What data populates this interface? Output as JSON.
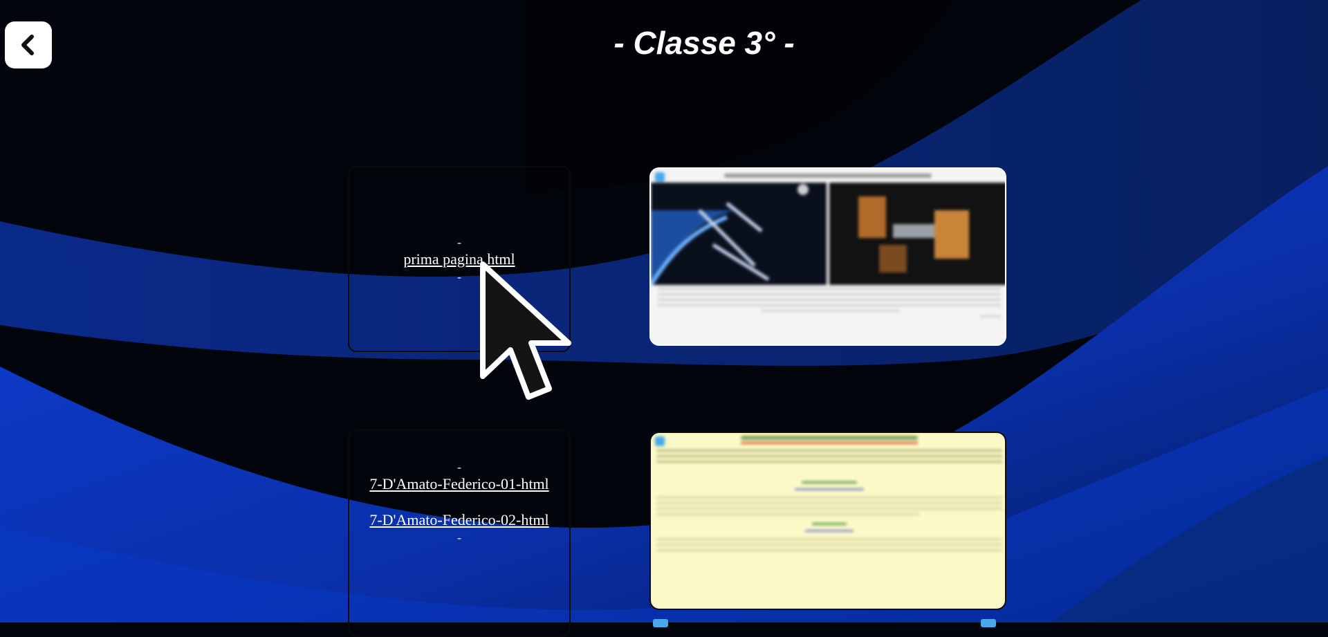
{
  "header": {
    "title": "- Classe 3° -",
    "back_icon": "chevron-left-icon"
  },
  "cards": [
    {
      "dash_top": "-",
      "links": [
        "prima pagina html"
      ],
      "dash_bottom": "-"
    },
    {
      "dash_top": "-",
      "links": [
        "7-D'Amato-Federico-01-html",
        "7-D'Amato-Federico-02-html"
      ],
      "dash_bottom": "-"
    }
  ],
  "previews": [
    {
      "kind": "thumbnail",
      "theme": "space-station",
      "background": "#f4f4f4"
    },
    {
      "kind": "thumbnail",
      "theme": "yellow-document",
      "background": "#fbf9c8"
    }
  ],
  "colors": {
    "page_background": "#02050c",
    "wave_blue": "#0a3ad0",
    "accent_badge": "#48a8e8"
  },
  "cursor_icon": "mouse-pointer-icon"
}
